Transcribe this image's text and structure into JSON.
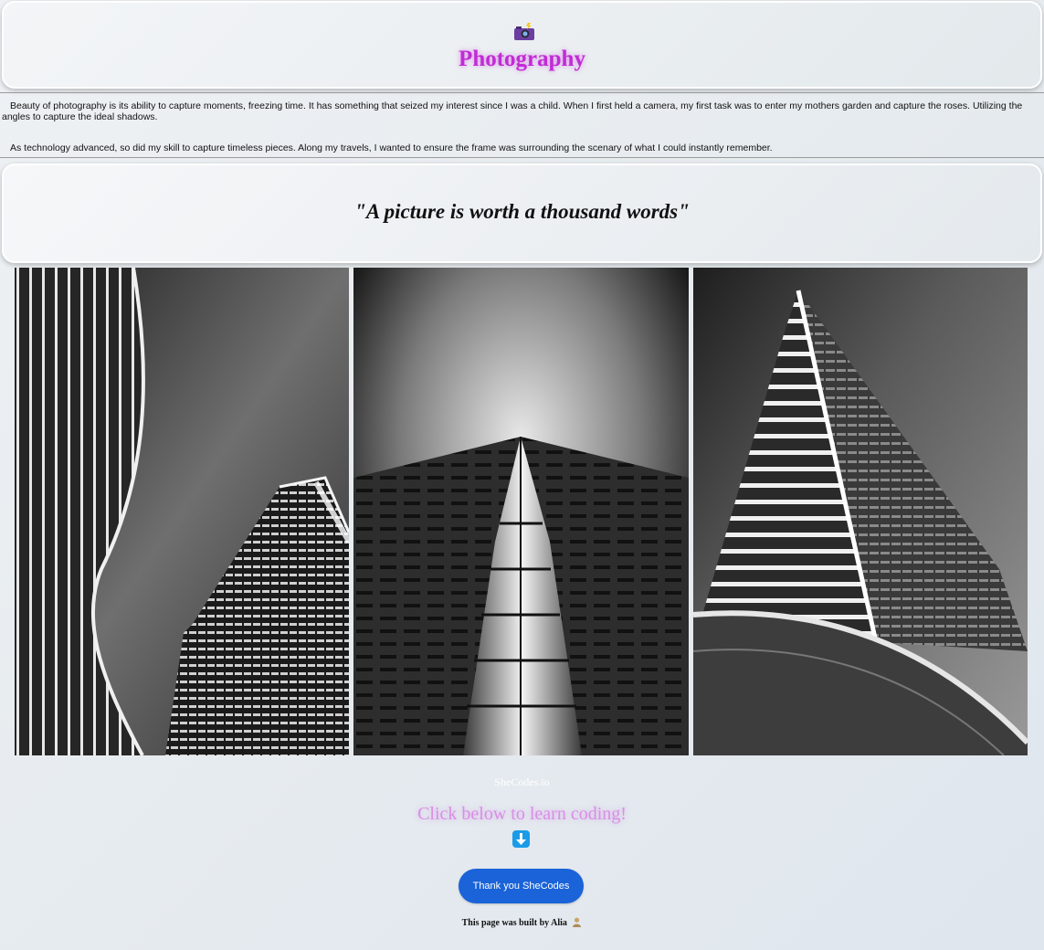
{
  "header": {
    "camera_icon": "camera-with-flash-icon",
    "title": "Photography",
    "title_color": "#c22bd6"
  },
  "intro": {
    "paragraph1": "Beauty of photography is its ability to capture moments, freezing time. It has something that seized my interest since I was a child. When I first held a camera, my first task was to enter my mothers garden and capture the roses. Utilizing the angles to capture the ideal shadows.",
    "paragraph2": "As technology advanced, so did my skill to capture timeless pieces. Along my travels, I wanted to ensure the frame was surrounding the scenary of what I could instantly remember."
  },
  "quote": {
    "text": "\"A picture is worth a thousand words\""
  },
  "gallery": {
    "images": [
      {
        "name": "curved-skyscrapers-photo",
        "description_icon": "black-and-white-architecture"
      },
      {
        "name": "tower-upward-view-photo",
        "description_icon": "black-and-white-architecture"
      },
      {
        "name": "triangular-tower-photo",
        "description_icon": "black-and-white-architecture"
      }
    ]
  },
  "footer": {
    "link_text": "SheCodes.io",
    "cta_text": "Click below to learn coding!",
    "cta_color": "#d98ee6",
    "arrow_icon": "down-arrow-icon",
    "button_label": "Thank you SheCodes",
    "button_color": "#1a63d8",
    "credit_text": "This page was built by Alia",
    "credit_icon": "person-icon"
  }
}
